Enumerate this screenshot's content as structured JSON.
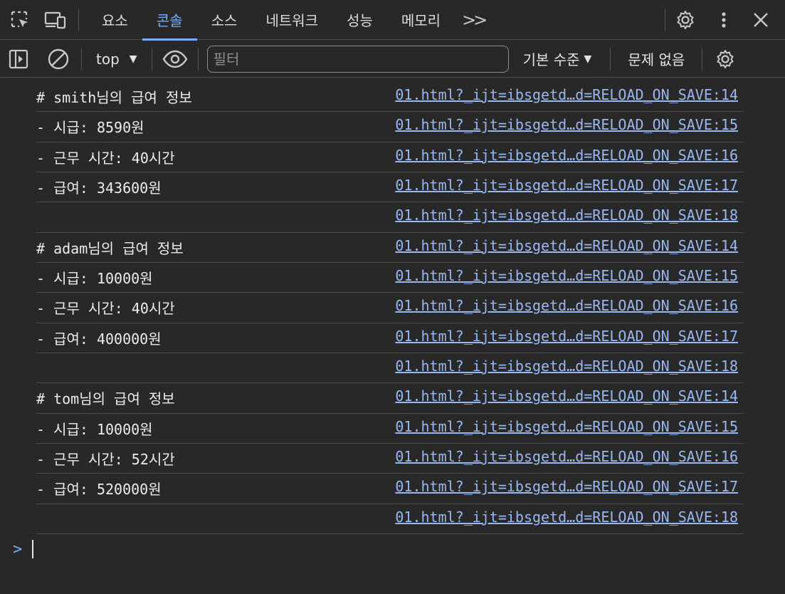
{
  "tabs": [
    {
      "label": "요소",
      "active": false
    },
    {
      "label": "콘솔",
      "active": true
    },
    {
      "label": "소스",
      "active": false
    },
    {
      "label": "네트워크",
      "active": false
    },
    {
      "label": "성능",
      "active": false
    },
    {
      "label": "메모리",
      "active": false
    }
  ],
  "tabbar": {
    "more_label": ">>"
  },
  "toolbar": {
    "context": "top",
    "filter_placeholder": "필터",
    "levels_label": "기본 수준",
    "issues_label": "문제 없음"
  },
  "messages": [
    {
      "text": "# smith님의 급여 정보",
      "source": "01.html?_ijt=ibsgetd…d=RELOAD_ON_SAVE:14"
    },
    {
      "text": "- 시급: 8590원",
      "source": "01.html?_ijt=ibsgetd…d=RELOAD_ON_SAVE:15"
    },
    {
      "text": "- 근무 시간: 40시간",
      "source": "01.html?_ijt=ibsgetd…d=RELOAD_ON_SAVE:16"
    },
    {
      "text": "- 급여: 343600원",
      "source": "01.html?_ijt=ibsgetd…d=RELOAD_ON_SAVE:17"
    },
    {
      "text": "",
      "source": "01.html?_ijt=ibsgetd…d=RELOAD_ON_SAVE:18"
    },
    {
      "text": "# adam님의 급여 정보",
      "source": "01.html?_ijt=ibsgetd…d=RELOAD_ON_SAVE:14"
    },
    {
      "text": "- 시급: 10000원",
      "source": "01.html?_ijt=ibsgetd…d=RELOAD_ON_SAVE:15"
    },
    {
      "text": "- 근무 시간: 40시간",
      "source": "01.html?_ijt=ibsgetd…d=RELOAD_ON_SAVE:16"
    },
    {
      "text": "- 급여: 400000원",
      "source": "01.html?_ijt=ibsgetd…d=RELOAD_ON_SAVE:17"
    },
    {
      "text": "",
      "source": "01.html?_ijt=ibsgetd…d=RELOAD_ON_SAVE:18"
    },
    {
      "text": "# tom님의 급여 정보",
      "source": "01.html?_ijt=ibsgetd…d=RELOAD_ON_SAVE:14"
    },
    {
      "text": "- 시급: 10000원",
      "source": "01.html?_ijt=ibsgetd…d=RELOAD_ON_SAVE:15"
    },
    {
      "text": "- 근무 시간: 52시간",
      "source": "01.html?_ijt=ibsgetd…d=RELOAD_ON_SAVE:16"
    },
    {
      "text": "- 급여: 520000원",
      "source": "01.html?_ijt=ibsgetd…d=RELOAD_ON_SAVE:17"
    },
    {
      "text": "",
      "source": "01.html?_ijt=ibsgetd…d=RELOAD_ON_SAVE:18"
    }
  ],
  "prompt": {
    "symbol": ">"
  },
  "icons": {
    "inspect": "inspect-element-icon",
    "device": "device-toolbar-icon",
    "settings": "gear-icon",
    "kebab": "more-vertical-icon",
    "close": "close-icon",
    "sidebar": "sidebar-toggle-icon",
    "clear": "clear-console-icon",
    "eye": "live-expression-eye-icon",
    "console_settings": "console-settings-gear-icon"
  }
}
